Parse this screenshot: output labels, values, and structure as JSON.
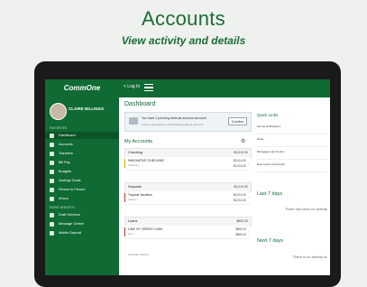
{
  "hero": {
    "title": "Accounts",
    "subtitle": "View activity and details"
  },
  "sidebar": {
    "logo": "CommOne",
    "user": "CLAIRE BILLINGS",
    "favorites_label": "FAVORITES",
    "favorites": [
      "Dashboard",
      "Accounts",
      "Transfers",
      "Bill Pay",
      "Budgets",
      "Savings Goals",
      "Person to Person",
      "eDocs"
    ],
    "more_label": "MORE WIDGETS",
    "more": [
      "Draft Services",
      "Message Center",
      "Mobile Deposit"
    ]
  },
  "topbar": {
    "login_label": "< Log In"
  },
  "dashboard": {
    "title": "Dashboard",
    "notice": {
      "text": "You have 1 pending external account account!",
      "subtext": "Confirm trial deposits to finish linking external accounts.",
      "button": "Confirm"
    },
    "my_accounts": "My Accounts",
    "groups": [
      {
        "name": "Checking",
        "total": "$3,010.00",
        "accounts": [
          {
            "name": "INNOVATIVE CHECKING",
            "number": "checking 1",
            "available": "$3,010.00",
            "current": "$3,010.00",
            "color": "#f0a500"
          }
        ]
      },
      {
        "name": "Deposits",
        "total": "$3,010.00",
        "accounts": [
          {
            "name": "Tropical Vacation",
            "number": "savings 1",
            "available": "$3,010.00",
            "current": "$3,010.00",
            "color": "#c0392b"
          }
        ]
      },
      {
        "name": "Loans",
        "total": "$550.00",
        "accounts": [
          {
            "name": "LINE OF CREDIT LOAN",
            "number": "loan 1",
            "available": "$550.00",
            "current": "$550.00",
            "color": "#c0392b"
          }
        ]
      }
    ],
    "more_accounts": "available balance"
  },
  "quick_links": {
    "title": "Quick Links",
    "items": [
      "Set Up Notifications",
      "Notes",
      "Mortgage Loan Center",
      "New Loans & Accounts"
    ]
  },
  "last7": [
    {
      "title": "Last 7 days",
      "empty": "There has been no activity"
    },
    {
      "title": "Next 7 days",
      "empty": "There is no activity sc"
    }
  ]
}
